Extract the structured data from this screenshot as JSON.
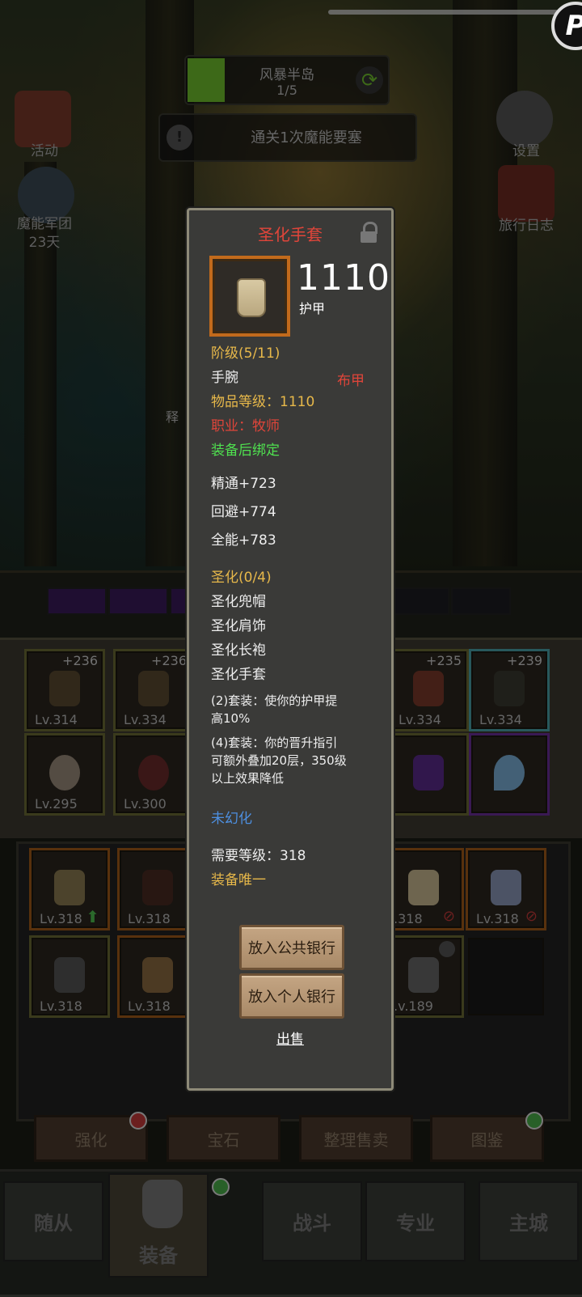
{
  "hud": {
    "zone_name": "风暴半岛",
    "zone_progress": "1/5",
    "quest_text": "通关1次魔能要塞",
    "activity_label": "活动",
    "legion_label": "魔能军团",
    "legion_days": "23天",
    "settings_label": "设置",
    "journal_label": "旅行日志",
    "partial_text": "释"
  },
  "tooltip": {
    "title": "圣化手套",
    "item_level_big": "1110",
    "stat_type": "护甲",
    "tier": "阶级(5/11)",
    "slot": "手腕",
    "armor_type": "布甲",
    "item_level_line": "物品等级：1110",
    "class_line": "职业：牧师",
    "bind_line": "装备后绑定",
    "stats": [
      "精通+723",
      "回避+774",
      "全能+783"
    ],
    "set_name": "圣化(0/4)",
    "set_items": [
      "圣化兜帽",
      "圣化肩饰",
      "圣化长袍",
      "圣化手套"
    ],
    "set_bonus_2_line1": "(2)套装：使你的护甲提",
    "set_bonus_2_line2": "高10%",
    "set_bonus_4_line1": "(4)套装：你的晋升指引",
    "set_bonus_4_line2": "可额外叠加20层，350级",
    "set_bonus_4_line3": "以上效果降低",
    "transmog": "未幻化",
    "required_level": "需要等级：318",
    "unique": "装备唯一",
    "btn_public_bank": "放入公共银行",
    "btn_personal_bank": "放入个人银行",
    "sell_link": "出售"
  },
  "equipment": {
    "row1": [
      {
        "plus": "+236",
        "lv": "Lv.314"
      },
      {
        "plus": "+236",
        "lv": "Lv.334"
      },
      {
        "plus": "+235",
        "lv": "Lv.334"
      },
      {
        "plus": "+239",
        "lv": "Lv.334"
      }
    ],
    "row2": [
      {
        "lv": "Lv.295"
      },
      {
        "lv": "Lv.300"
      }
    ]
  },
  "bag": {
    "row1": [
      "Lv.318",
      "Lv.318",
      ".318",
      "Lv.318"
    ],
    "row2": [
      "Lv.318",
      "Lv.318",
      ".v.189"
    ]
  },
  "actions": {
    "enhance": "强化",
    "gem": "宝石",
    "sort_sell": "整理售卖",
    "codex": "图鉴"
  },
  "nav": {
    "followers": "随从",
    "equipment": "装备",
    "battle": "战斗",
    "profession": "专业",
    "city": "主城"
  },
  "colors": {
    "title_red": "#e0453a",
    "gold": "#e7b84a",
    "green": "#4fe04f",
    "blue": "#4d8fe0",
    "item_frame_orange": "#c26a1c"
  }
}
